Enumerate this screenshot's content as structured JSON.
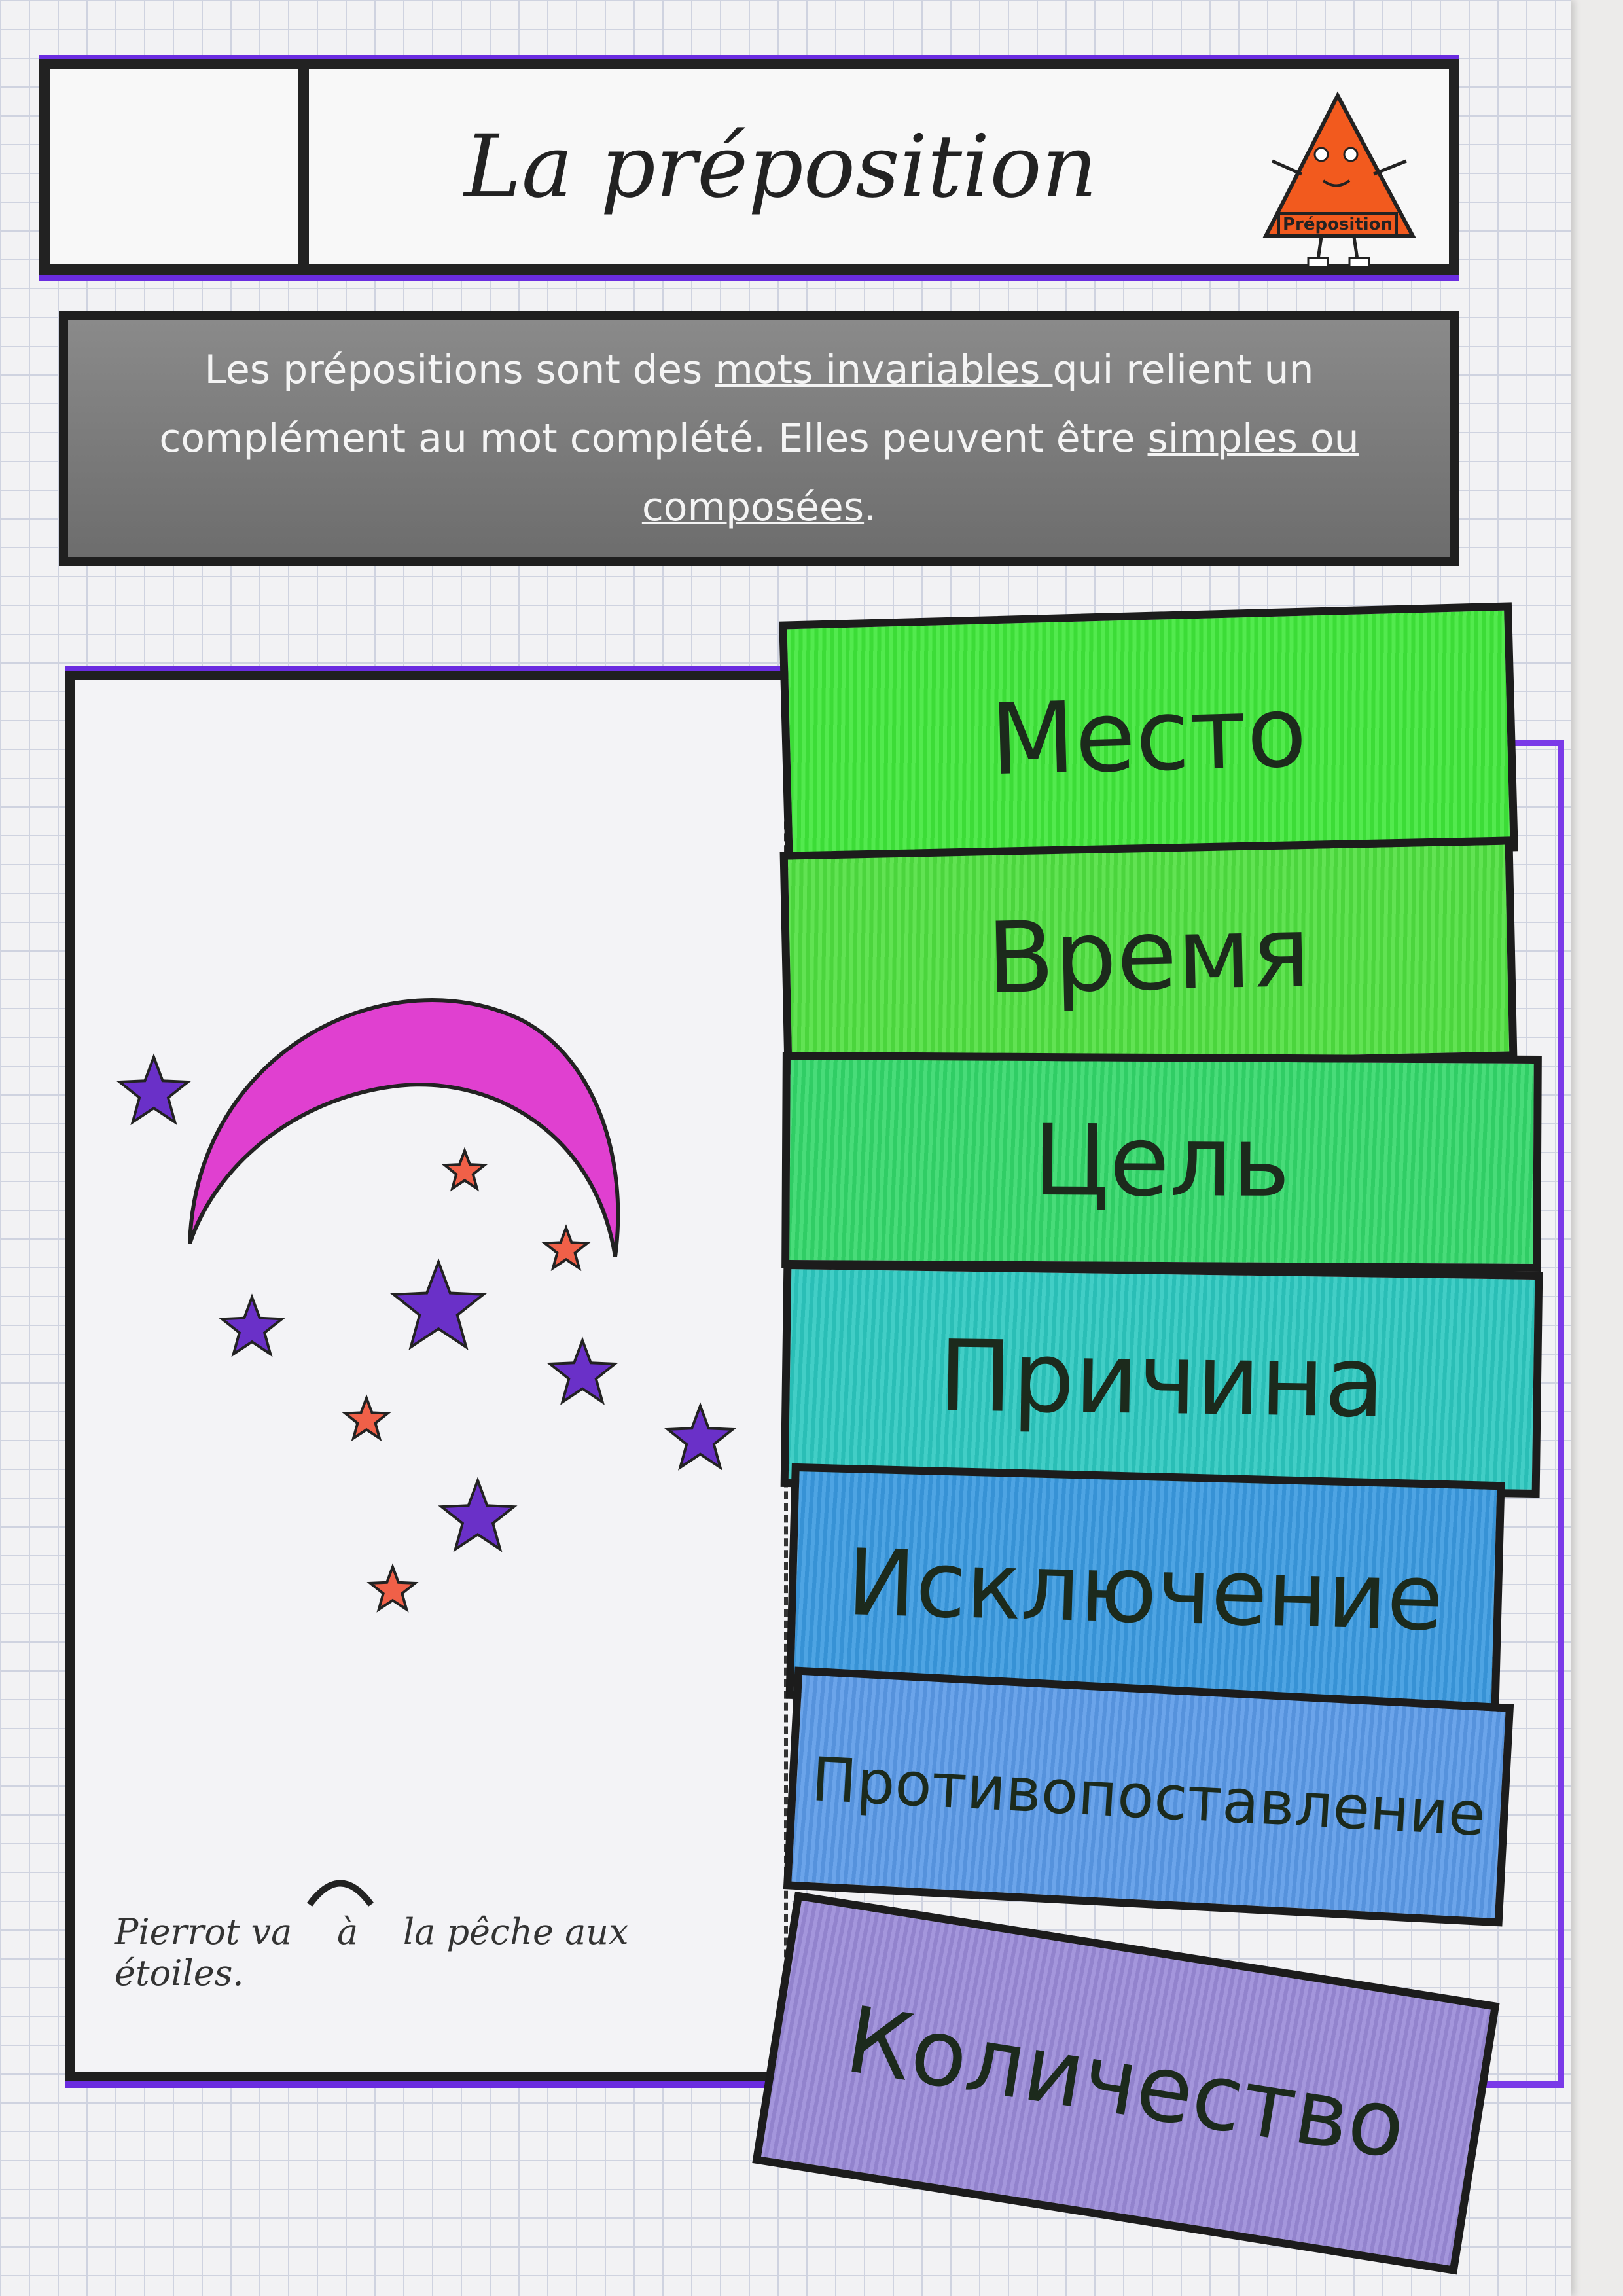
{
  "header": {
    "title": "La préposition",
    "mascot_label": "Préposition"
  },
  "definition": {
    "part1": "Les prépositions sont des ",
    "underlined1": "mots invariables ",
    "part2": "qui relient un complément au mot complété. Elles peuvent être ",
    "underlined2": "simples ou composées",
    "part3": "."
  },
  "example": {
    "before": "Pierrot va",
    "preposition": "à",
    "after": "la pêche aux étoiles."
  },
  "tabs": [
    {
      "label": "Место",
      "color": "#3fe83a"
    },
    {
      "label": "Время",
      "color": "#4fe040"
    },
    {
      "label": "Цель",
      "color": "#33d86a"
    },
    {
      "label": "Причина",
      "color": "#2cc8c0"
    },
    {
      "label": "Исключение",
      "color": "#3a9ae0"
    },
    {
      "label": "Противопоставление",
      "color": "#5a9ae8"
    },
    {
      "label": "Количество",
      "color": "#9a8ad8"
    }
  ],
  "colors": {
    "moon": "#e040d0",
    "star_large": "#6a30c8",
    "star_small": "#f06048",
    "accent_border": "#6a2ce0"
  }
}
